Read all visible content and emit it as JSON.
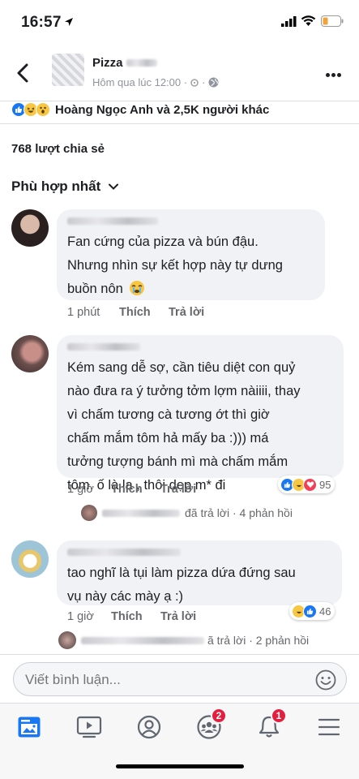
{
  "status_bar": {
    "time": "16:57"
  },
  "header": {
    "page_name": "Pizza",
    "post_time": "Hôm qua lúc 12:00 ·"
  },
  "reactions": {
    "summary": "Hoàng Ngọc Anh và 2,5K người khác"
  },
  "shares": "768 lượt chia sẻ",
  "sort_label": "Phù hợp nhất",
  "comments": [
    {
      "text_lines": [
        "Fan cứng của pizza và bún đậu.",
        "Nhưng nhìn sự kết hợp này tự dưng",
        "buồn nôn"
      ],
      "time": "1 phút",
      "like_label": "Thích",
      "reply_label": "Trả lời"
    },
    {
      "text_lines": [
        "Kém sang dễ sợ, cần tiêu diệt con quỷ",
        "nào đưa ra ý tưởng tởm lợm nàiiii, thay",
        "vì chấm tương cà tương ớt thì giờ",
        "chấm mắm tôm hả mấy ba :))) má",
        "tưởng tượng bánh mì mà chấm mắm",
        "tôm, ố là la , thôi dẹp m* đi"
      ],
      "time": "1 giờ",
      "like_label": "Thích",
      "reply_label": "Trả lời",
      "reaction_count": "95",
      "replies_text": "đã trả lời · 4 phản hồi"
    },
    {
      "text_lines": [
        "tao nghĩ là tụi làm pizza dứa đứng sau",
        "vụ này các mày ạ :)"
      ],
      "time": "1 giờ",
      "like_label": "Thích",
      "reply_label": "Trả lời",
      "reaction_count": "46",
      "replies_text": "ã trả lời · 2 phản hồi"
    }
  ],
  "composer": {
    "placeholder": "Viết bình luận..."
  },
  "tabbar": {
    "groups_badge": "2",
    "notifications_badge": "1"
  },
  "colors": {
    "accent": "#1877f2",
    "badge": "#e41e3f",
    "muted": "#65676b"
  }
}
